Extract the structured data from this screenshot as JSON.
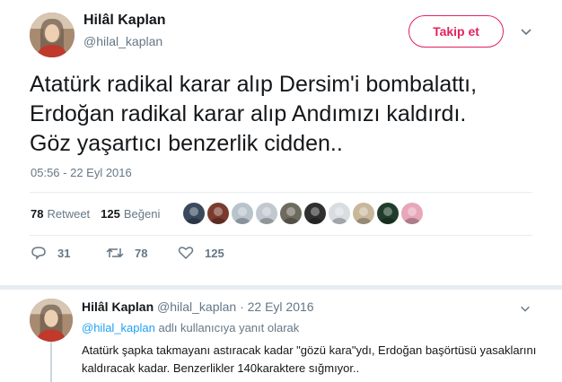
{
  "tweet": {
    "author_name": "Hilâl Kaplan",
    "author_handle": "@hilal_kaplan",
    "follow_label": "Takip et",
    "text_lines": [
      "Atatürk radikal karar alıp Dersim'i bombalattı,",
      "Erdoğan radikal karar alıp Andımızı kaldırdı.",
      "Göz yaşartıcı benzerlik cidden.."
    ],
    "timestamp": "05:56 - 22 Eyl 2016",
    "retweet_count": "78",
    "retweet_label": "Retweet",
    "like_count": "125",
    "like_label": "Beğeni",
    "liker_avatars": [
      "#3a4a5c",
      "#7a3b2e",
      "#b9c3cc",
      "#c2c8cf",
      "#6e6a5e",
      "#2f2f2f",
      "#d8dde2",
      "#c9b79c",
      "#1f3d2a",
      "#e6a7b8"
    ]
  },
  "actions": {
    "reply_count": "31",
    "retweet_count": "78",
    "like_count": "125"
  },
  "reply": {
    "author_name": "Hilâl Kaplan",
    "author_handle": "@hilal_kaplan",
    "date": "· 22 Eyl 2016",
    "replying_to_handle": "@hilal_kaplan",
    "replying_to_suffix": " adlı kullanıcıya yanıt olarak",
    "text": "Atatürk şapka takmayanı astıracak kadar \"gözü kara\"ydı, Erdoğan başörtüsü yasaklarını kaldıracak kadar. Benzerlikler 140karaktere sığmıyor.."
  },
  "colors": {
    "accent_pink": "#e0245e",
    "link_blue": "#1da1f2",
    "muted_gray": "#657786"
  },
  "icons": [
    "chevron-down-icon",
    "reply-icon",
    "retweet-icon",
    "like-icon"
  ]
}
